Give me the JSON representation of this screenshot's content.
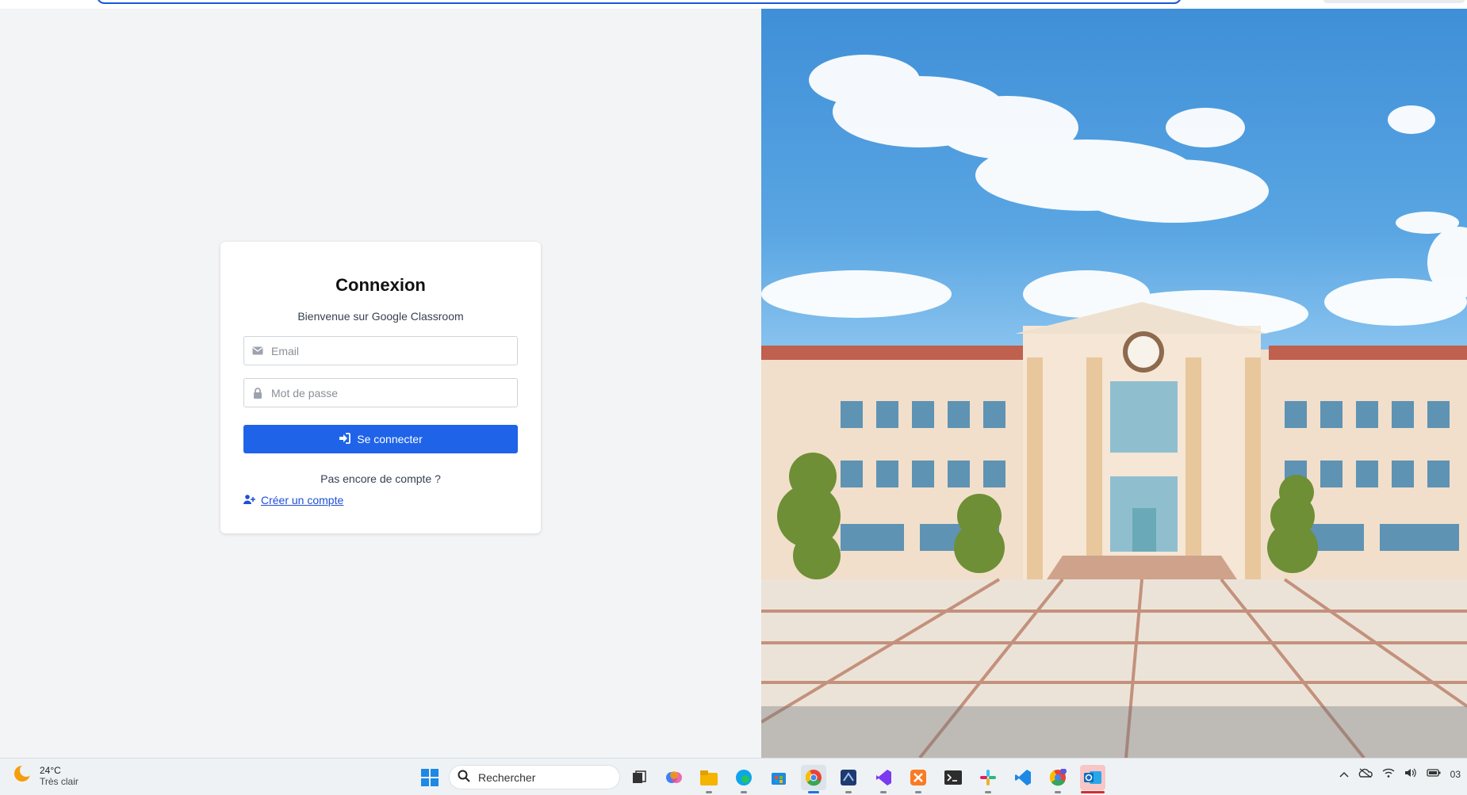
{
  "login": {
    "title": "Connexion",
    "subtitle": "Bienvenue sur Google Classroom",
    "email_placeholder": "Email",
    "password_placeholder": "Mot de passe",
    "submit_label": "Se connecter",
    "no_account_text": "Pas encore de compte ?",
    "create_account_label": "Créer un compte"
  },
  "colors": {
    "accent": "#1f63e9",
    "link": "#1f4fd8",
    "page_bg": "#f3f4f6"
  },
  "taskbar": {
    "weather_temp": "24°C",
    "weather_condition": "Très clair",
    "search_placeholder": "Rechercher",
    "clock_partial": "03",
    "pinned_apps": [
      "windows-start-icon",
      "file-explorer-icon",
      "copilot-icon",
      "folder-icon",
      "edge-icon",
      "store-icon",
      "chrome-icon",
      "app-icon",
      "visual-studio-icon",
      "xampp-icon",
      "terminal-icon",
      "slack-icon",
      "vscode-icon",
      "chrome-profile-icon",
      "outlook-icon"
    ]
  }
}
